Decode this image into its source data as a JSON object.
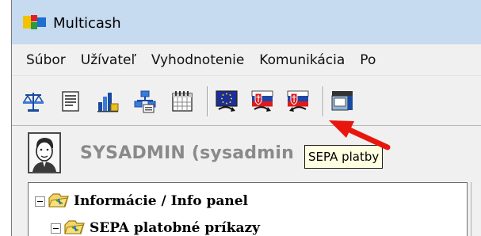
{
  "window": {
    "title": "Multicash"
  },
  "menu": [
    "Súbor",
    "Užívateľ",
    "Vyhodnotenie",
    "Komunikácia",
    "Po"
  ],
  "toolbar": {
    "icons": [
      "scales-icon",
      "document-icon",
      "bar-chart-icon",
      "organization-icon",
      "calendar-icon",
      "sepa-eu-icon",
      "slovak-flag-icon",
      "slovak-flag-arrow-icon",
      "terminal-icon"
    ]
  },
  "user": {
    "label": "SYSADMIN (sysadmin"
  },
  "tooltip": {
    "text": "SEPA platby"
  },
  "tree": {
    "items": [
      {
        "label": "Informácie / Info panel"
      },
      {
        "label": "SEPA platobné príkazy"
      }
    ]
  },
  "colors": {
    "annotation_arrow": "#e8160c",
    "titlebar": "#c6daf0",
    "tooltip_bg": "#ffffe1"
  }
}
